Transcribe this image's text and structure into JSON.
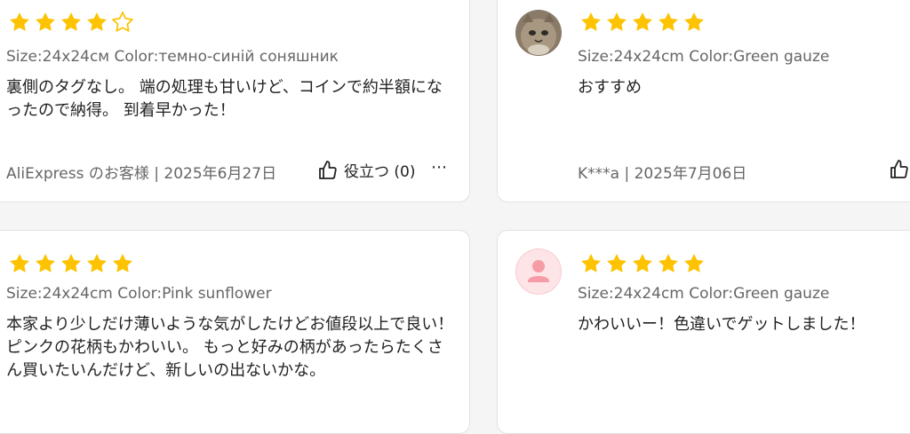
{
  "colors": {
    "star_fill": "#fdc301",
    "star_empty_stroke": "#fdc301",
    "avatar_pink_bg": "#fde4e6",
    "avatar_pink_fg": "#f69ca6"
  },
  "reviews": [
    {
      "rating": 4,
      "meta": "Size:24x24см Color:темно-синій соняшник",
      "content": "裏側のタグなし。 端の処理も甘いけど、コインで約半額になったので納得。 到着早かった！",
      "author_date": "AliExpress のお客様 | 2025年6月27日",
      "helpful_label": "役立つ (0)",
      "more_label": "⋯"
    },
    {
      "rating": 5,
      "avatar": "cat-photo",
      "meta": "Size:24x24cm Color:Green gauze",
      "content": "おすすめ",
      "author_date": "K***a | 2025年7月06日"
    },
    {
      "rating": 5,
      "meta": "Size:24x24cm Color:Pink sunflower",
      "content": "本家より少しだけ薄いような気がしたけどお値段以上で良い！ ピンクの花柄もかわいい。 もっと好みの柄があったらたくさん買いたいんだけど、新しいの出ないかな。"
    },
    {
      "rating": 5,
      "avatar": "default-user",
      "meta": "Size:24x24cm Color:Green gauze",
      "content": "かわいいー！色違いでゲットしました！"
    }
  ]
}
